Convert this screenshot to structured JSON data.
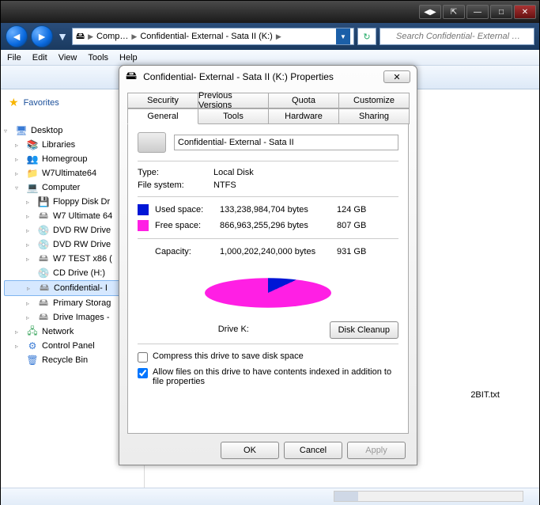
{
  "window": {
    "nav": {
      "crumb1": "Comp…",
      "crumb2": "Confidential- External - Sata II (K:)",
      "refresh_icon": "↻"
    },
    "search_placeholder": "Search Confidential- External …",
    "menu": {
      "file": "File",
      "edit": "Edit",
      "view": "View",
      "tools": "Tools",
      "help": "Help"
    }
  },
  "tree": {
    "favorites": "Favorites",
    "desktop": "Desktop",
    "libraries": "Libraries",
    "homegroup": "Homegroup",
    "w7ultimate": "W7Ultimate64",
    "computer": "Computer",
    "floppy": "Floppy Disk Dr",
    "w7ult64": "W7 Ultimate 64",
    "dvdrw1": "DVD RW Drive",
    "dvdrw2": "DVD RW Drive",
    "w7test": "W7 TEST x86 (",
    "cddrive": "CD Drive (H:)",
    "confidential": "Confidential- I",
    "primary": "Primary Storag",
    "driveimg": "Drive Images -",
    "network": "Network",
    "cpanel": "Control Panel",
    "recycle": "Recycle Bin"
  },
  "content": {
    "file_in_bg": "2BIT.txt"
  },
  "dialog": {
    "title": "Confidential- External - Sata II (K:) Properties",
    "tabs_top": {
      "security": "Security",
      "prev": "Previous Versions",
      "quota": "Quota",
      "customize": "Customize"
    },
    "tabs_bot": {
      "general": "General",
      "tools": "Tools",
      "hardware": "Hardware",
      "sharing": "Sharing"
    },
    "drive_name": "Confidential- External - Sata II",
    "type_k": "Type:",
    "type_v": "Local Disk",
    "fs_k": "File system:",
    "fs_v": "NTFS",
    "used_k": "Used space:",
    "used_bytes": "133,238,984,704 bytes",
    "used_gb": "124 GB",
    "free_k": "Free space:",
    "free_bytes": "866,963,255,296 bytes",
    "free_gb": "807 GB",
    "cap_k": "Capacity:",
    "cap_bytes": "1,000,202,240,000 bytes",
    "cap_gb": "931 GB",
    "pie_label": "Drive K:",
    "cleanup": "Disk Cleanup",
    "compress": "Compress this drive to save disk space",
    "index": "Allow files on this drive to have contents indexed in addition to file properties",
    "ok": "OK",
    "cancel": "Cancel",
    "apply": "Apply"
  },
  "chart_data": {
    "type": "pie",
    "title": "Drive K:",
    "series": [
      {
        "name": "Used space",
        "value": 133238984704,
        "display": "124 GB",
        "color": "#0016d6"
      },
      {
        "name": "Free space",
        "value": 866963255296,
        "display": "807 GB",
        "color": "#ff1fe4"
      }
    ],
    "total": {
      "value": 1000202240000,
      "display": "931 GB"
    }
  }
}
